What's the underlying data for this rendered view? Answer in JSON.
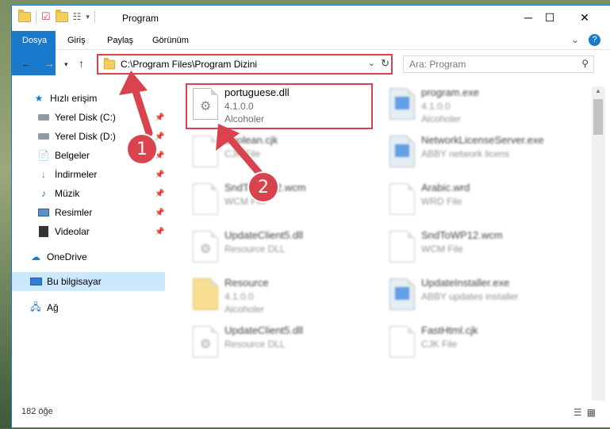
{
  "window": {
    "title": "Program",
    "minimize": "─",
    "maximize": "☐",
    "close": "✕"
  },
  "ribbon": {
    "tabs": [
      "Dosya",
      "Giriş",
      "Paylaş",
      "Görünüm"
    ],
    "collapse": "⌄",
    "help": "?"
  },
  "address": {
    "path": "C:\\Program Files\\Program Dizini",
    "search_placeholder": "Ara: Program"
  },
  "sidebar": {
    "items": [
      {
        "label": "Hızlı erişim",
        "icon": "star-icon",
        "pinned": false
      },
      {
        "label": "Yerel Disk (C:)",
        "icon": "drive-icon",
        "pinned": true
      },
      {
        "label": "Yerel Disk (D:)",
        "icon": "drive-icon",
        "pinned": true
      },
      {
        "label": "Belgeler",
        "icon": "documents-icon",
        "pinned": true
      },
      {
        "label": "İndirmeler",
        "icon": "download-icon",
        "pinned": true
      },
      {
        "label": "Müzik",
        "icon": "music-icon",
        "pinned": true
      },
      {
        "label": "Resimler",
        "icon": "pictures-icon",
        "pinned": true
      },
      {
        "label": "Videolar",
        "icon": "videos-icon",
        "pinned": true
      },
      {
        "label": "OneDrive",
        "icon": "onedrive-icon",
        "pinned": false
      },
      {
        "label": "Bu bilgisayar",
        "icon": "computer-icon",
        "pinned": false
      },
      {
        "label": "Ağ",
        "icon": "network-icon",
        "pinned": false
      }
    ]
  },
  "files": [
    {
      "name": "portuguese.dll",
      "line1": "4.1.0.0",
      "line2": "Alcoholer",
      "icon": "dll-icon"
    },
    {
      "name": "program.exe",
      "line1": "4.1.0.0",
      "line2": "Alcoholer",
      "icon": "exe-icon"
    },
    {
      "name": "Boolean.cjk",
      "line1": "CJK File",
      "line2": "",
      "icon": "file-icon"
    },
    {
      "name": "NetworkLicenseServer.exe",
      "line1": "ABBY network licens",
      "line2": "",
      "icon": "exe-icon"
    },
    {
      "name": "SndToWP12.wcm",
      "line1": "WCM File",
      "line2": "",
      "icon": "file-icon"
    },
    {
      "name": "Arabic.wrd",
      "line1": "WRD File",
      "line2": "",
      "icon": "file-icon"
    },
    {
      "name": "UpdateClient5.dll",
      "line1": "Resource DLL",
      "line2": "",
      "icon": "dll-icon"
    },
    {
      "name": "SndToWP12.wcm",
      "line1": "WCM File",
      "line2": "",
      "icon": "file-icon"
    },
    {
      "name": "Resource",
      "line1": "4.1.0.0",
      "line2": "Alcoholer",
      "icon": "folder-icon"
    },
    {
      "name": "UpdateInstaller.exe",
      "line1": "ABBY updates installer",
      "line2": "",
      "icon": "exe-icon"
    },
    {
      "name": "UpdateClient5.dll",
      "line1": "Resource DLL",
      "line2": "",
      "icon": "dll-icon"
    },
    {
      "name": "FastHtml.cjk",
      "line1": "CJK File",
      "line2": "",
      "icon": "file-icon"
    }
  ],
  "status": {
    "count": "182 öğe"
  },
  "annotations": {
    "badge1": "1",
    "badge2": "2"
  }
}
